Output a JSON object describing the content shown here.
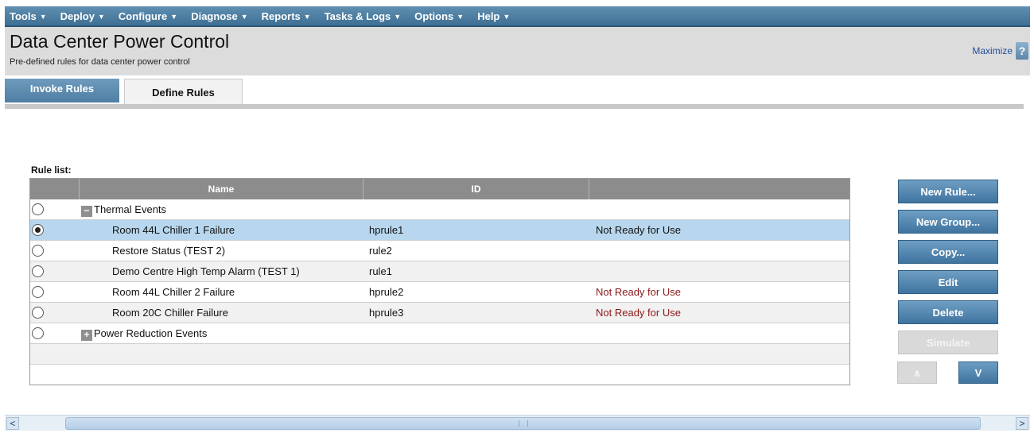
{
  "menu": {
    "items": [
      "Tools",
      "Deploy",
      "Configure",
      "Diagnose",
      "Reports",
      "Tasks & Logs",
      "Options",
      "Help"
    ]
  },
  "header": {
    "title": "Data Center Power Control",
    "subtitle": "Pre-defined rules for data center power control",
    "maximize_label": "Maximize",
    "help_label": "?"
  },
  "tabs": [
    {
      "label": "Invoke Rules",
      "active": false
    },
    {
      "label": "Define Rules",
      "active": true
    }
  ],
  "rule_list": {
    "label": "Rule list:",
    "columns": {
      "name": "Name",
      "id": "ID",
      "status": ""
    },
    "groups": [
      {
        "name": "Thermal Events",
        "expanded": true,
        "toggle": "−",
        "rules": [
          {
            "name": "Room 44L Chiller 1 Failure",
            "id": "hprule1",
            "status": "Not Ready for Use",
            "selected": true
          },
          {
            "name": "Restore Status (TEST 2)",
            "id": "rule2",
            "status": ""
          },
          {
            "name": "Demo Centre High Temp Alarm (TEST 1)",
            "id": "rule1",
            "status": ""
          },
          {
            "name": "Room 44L Chiller 2 Failure",
            "id": "hprule2",
            "status": "Not Ready for Use"
          },
          {
            "name": "Room 20C Chiller Failure",
            "id": "hprule3",
            "status": "Not Ready for Use"
          }
        ]
      },
      {
        "name": "Power Reduction Events",
        "expanded": false,
        "toggle": "+",
        "rules": []
      }
    ]
  },
  "actions": {
    "new_rule": "New Rule...",
    "new_group": "New Group...",
    "copy": "Copy...",
    "edit": "Edit",
    "delete": "Delete",
    "simulate": "Simulate",
    "move_up": "∧",
    "move_down": "V"
  },
  "scrollbar": {
    "left": "<",
    "right": ">"
  },
  "colors": {
    "menu_bar": "#4f7fa4",
    "selected_row": "#b8d7ee",
    "warning_text": "#8b1a1a",
    "button": "#4f84ae"
  }
}
